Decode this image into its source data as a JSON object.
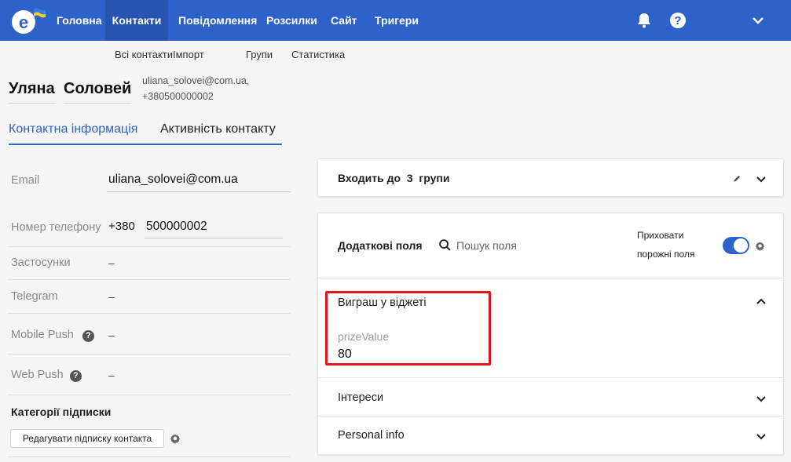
{
  "nav": {
    "items": [
      "Головна",
      "Контакти",
      "Повідомлення",
      "Розсилки",
      "Сайт",
      "Тригери"
    ],
    "active_index": 1,
    "brand_color": "#2d62c8"
  },
  "subnav": {
    "items": [
      "Всі контакти",
      "Імпорт",
      "Групи",
      "Статистика"
    ]
  },
  "contact": {
    "first_name": "Уляна",
    "last_name": "Соловей",
    "email_header": "uliana_solovei@com.ua,",
    "phone_header": "+380500000002"
  },
  "tabs": [
    "Контактна інформація",
    "Активність контакту"
  ],
  "fields": {
    "email_label": "Email",
    "email_value": "uliana_solovei@com.ua",
    "phone_label": "Номер телефону",
    "phone_code": "+380",
    "phone_number": "500000002",
    "apps_label": "Застосунки",
    "apps_value": "–",
    "telegram_label": "Telegram",
    "telegram_value": "–",
    "mobile_push_label": "Mobile Push",
    "mobile_push_value": "–",
    "web_push_label": "Web Push",
    "web_push_value": "–"
  },
  "subscriptions": {
    "title": "Категорії підписки",
    "edit_button": "Редагувати підписку контакта"
  },
  "groups_card": {
    "prefix": "Входить до",
    "count": "3",
    "suffix": "групи"
  },
  "extra_fields_card": {
    "title": "Додаткові поля",
    "search_placeholder": "Пошук поля",
    "hide_empty_line1": "Приховати",
    "hide_empty_line2": "порожні поля",
    "hide_empty_on": true,
    "sections": [
      {
        "title": "Виграш у віджеті",
        "field_label": "prizeValue",
        "field_value": "80"
      },
      {
        "title": "Інтереси"
      },
      {
        "title": "Personal info"
      }
    ]
  },
  "highlight_color": "#e8141c"
}
